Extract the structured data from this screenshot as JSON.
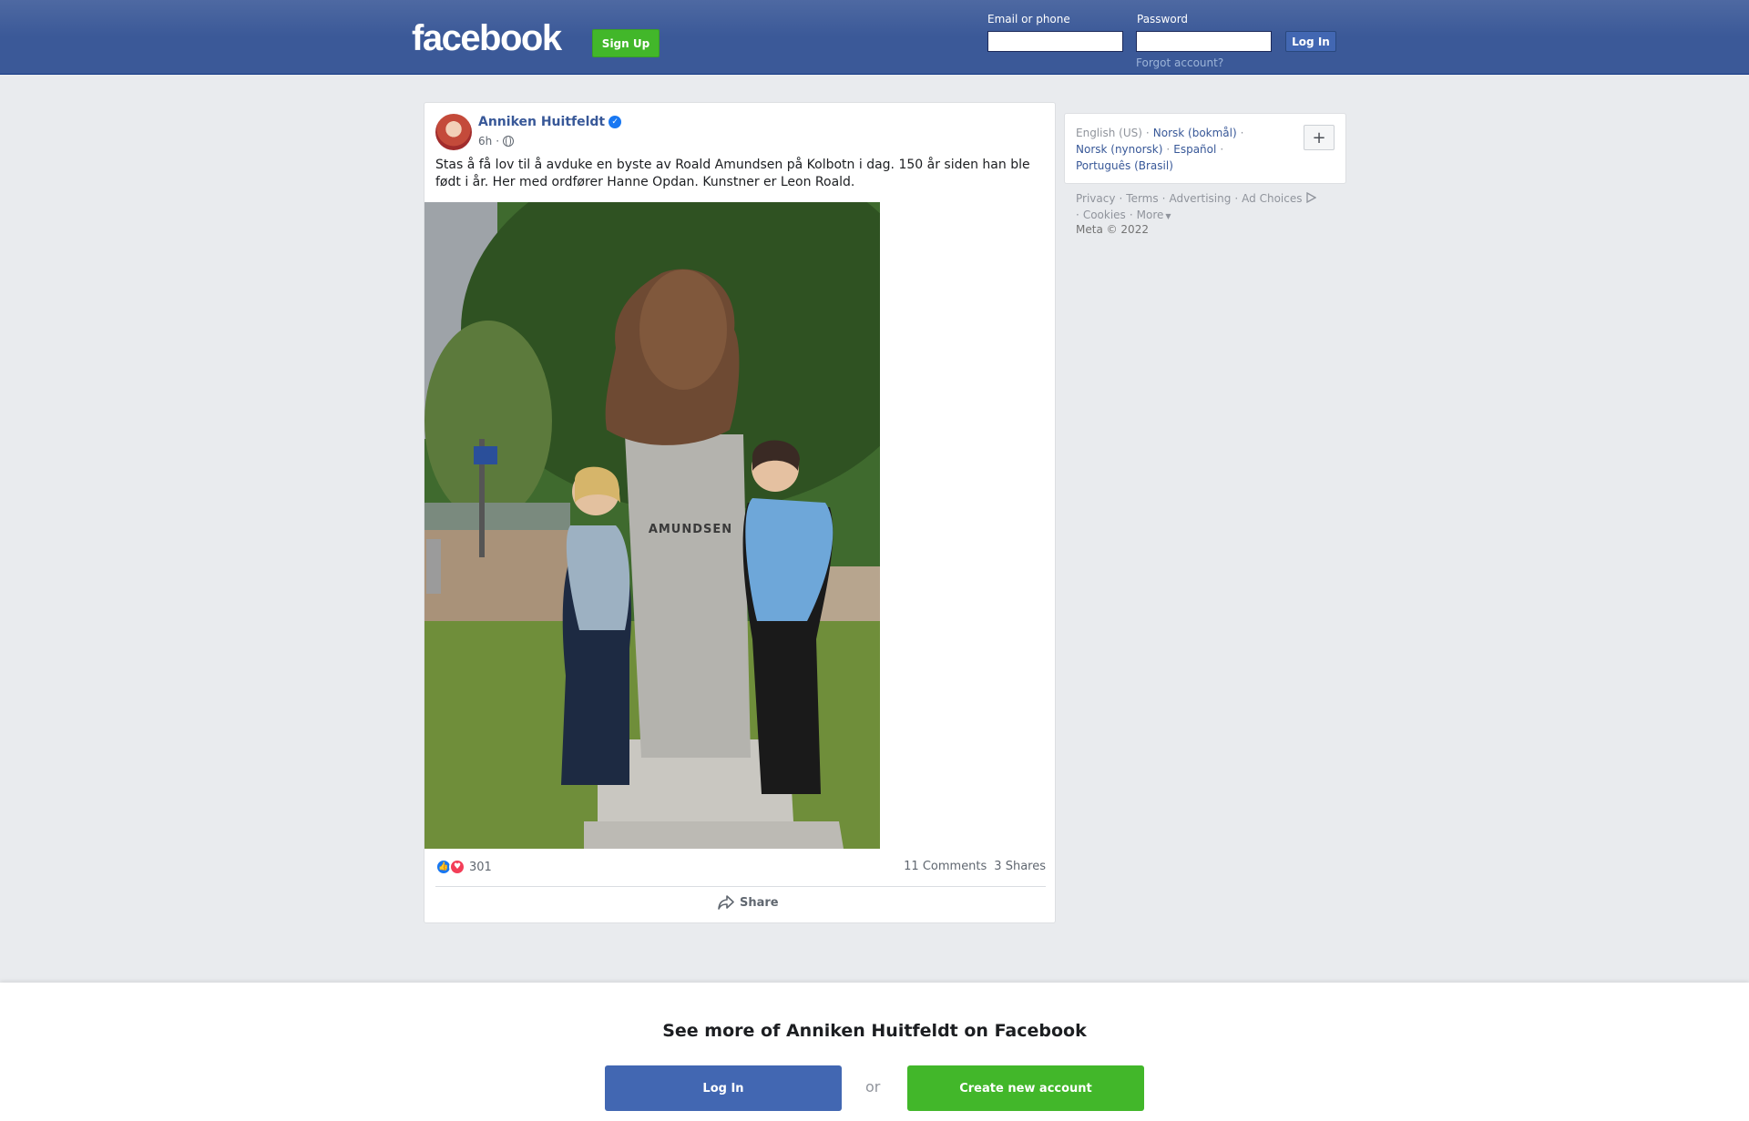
{
  "header": {
    "logo": "facebook",
    "signup_label": "Sign Up",
    "email_label": "Email or phone",
    "password_label": "Password",
    "login_label": "Log In",
    "forgot_label": "Forgot account?"
  },
  "post": {
    "author": "Anniken Huitfeldt",
    "time": "6h",
    "separator": "·",
    "text": "Stas å få lov til å avduke en byste av Roald Amundsen på Kolbotn i dag. 150 år siden han ble født i år. Her med ordfører Hanne Opdan. Kunstner er Leon Roald.",
    "image": {
      "inscription": "AMUNDSEN"
    },
    "reaction_count": "301",
    "comments": "11 Comments",
    "shares": "3 Shares",
    "share_label": "Share"
  },
  "sidebar": {
    "current_language": "English (US)",
    "languages": [
      "Norsk (bokmål)",
      "Norsk (nynorsk)",
      "Español",
      "Português (Brasil)"
    ],
    "more_languages_symbol": "+",
    "footer_links": [
      "Privacy",
      "Terms",
      "Advertising",
      "Ad Choices",
      "Cookies",
      "More"
    ],
    "copyright": "Meta © 2022"
  },
  "bottom_bar": {
    "title": "See more of Anniken Huitfeldt on Facebook",
    "login_label": "Log In",
    "or_label": "or",
    "create_label": "Create new account"
  },
  "colors": {
    "brand_blue": "#3b5998",
    "button_blue": "#4267b2",
    "signup_green": "#42b72a",
    "link_blue": "#385898"
  }
}
